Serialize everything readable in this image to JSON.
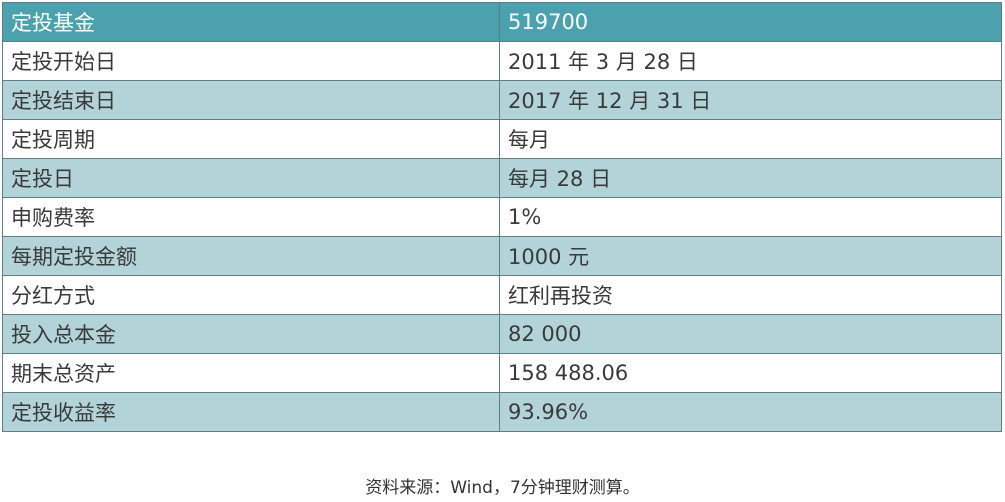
{
  "table": {
    "header": {
      "label": "定投基金",
      "value": "519700"
    },
    "rows": [
      {
        "label": "定投开始日",
        "value": "2011 年 3 月 28 日"
      },
      {
        "label": "定投结束日",
        "value": "2017 年 12 月 31 日"
      },
      {
        "label": "定投周期",
        "value": "每月"
      },
      {
        "label": "定投日",
        "value": "每月 28 日"
      },
      {
        "label": "申购费率",
        "value": "1%"
      },
      {
        "label": "每期定投金额",
        "value": "1000 元"
      },
      {
        "label": "分红方式",
        "value": "红利再投资"
      },
      {
        "label": "投入总本金",
        "value": "82 000"
      },
      {
        "label": "期末总资产",
        "value": "158 488.06"
      },
      {
        "label": "定投收益率",
        "value": "93.96%"
      }
    ]
  },
  "source_note": "资料来源：Wind，7分钟理财测算。",
  "colors": {
    "header_bg": "#4ba1ad",
    "shaded_row_bg": "#b2d4d9",
    "plain_row_bg": "#ffffff"
  }
}
